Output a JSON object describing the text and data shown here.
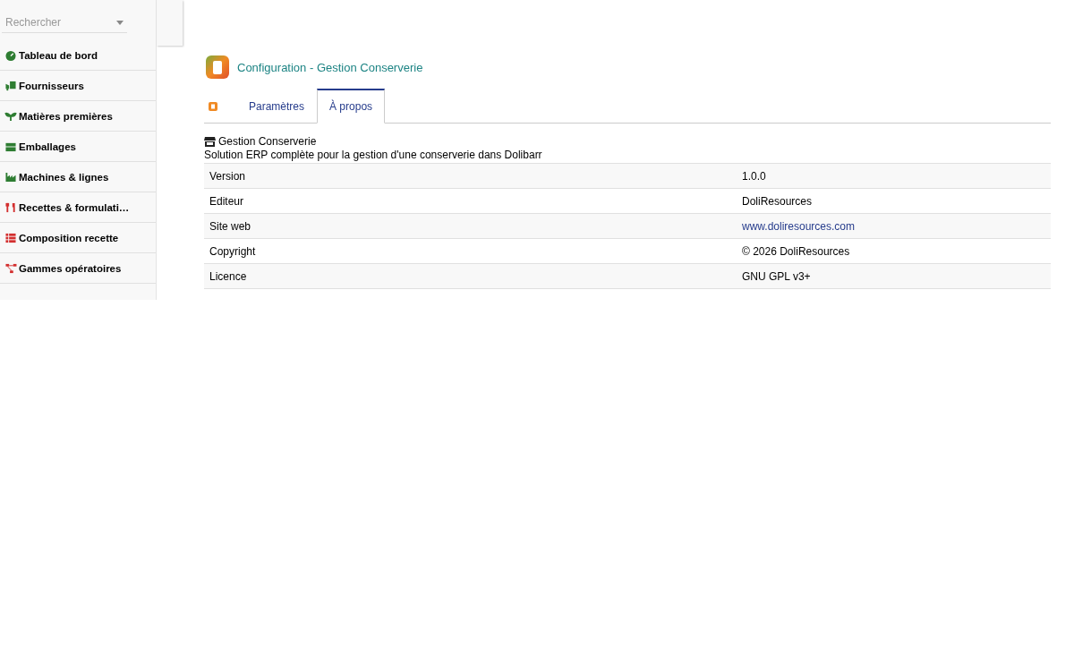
{
  "sidebar": {
    "search": {
      "placeholder": "Rechercher"
    },
    "items": [
      {
        "label": "Tableau de bord",
        "kind": "gauge",
        "color": "#2e7d32"
      },
      {
        "label": "Fournisseurs",
        "kind": "truck",
        "color": "#2e7d32"
      },
      {
        "label": "Matières premières",
        "kind": "sprout",
        "color": "#2e7d32"
      },
      {
        "label": "Emballages",
        "kind": "box",
        "color": "#2e7d32"
      },
      {
        "label": "Machines & lignes",
        "kind": "factory",
        "color": "#2e7d32"
      },
      {
        "label": "Recettes & formulati…",
        "kind": "utensils",
        "color": "#d32f2f"
      },
      {
        "label": "Composition recette",
        "kind": "list",
        "color": "#d32f2f"
      },
      {
        "label": "Gammes opératoires",
        "kind": "flow",
        "color": "#d32f2f"
      }
    ]
  },
  "page": {
    "title": "Configuration - Gestion Conserverie",
    "tabs": [
      {
        "label": "Paramètres",
        "selected": false
      },
      {
        "label": "À propos",
        "selected": true
      }
    ],
    "module_name": "Gestion Conserverie",
    "description": "Solution ERP complète pour la gestion d'une conserverie dans Dolibarr",
    "table": {
      "rows": [
        {
          "label": "Version",
          "value": "1.0.0",
          "kind": "text"
        },
        {
          "label": "Editeur",
          "value": "DoliResources",
          "kind": "text"
        },
        {
          "label": "Site web",
          "value": "www.doliresources.com",
          "kind": "link"
        },
        {
          "label": "Copyright",
          "value": "© 2026 DoliResources",
          "kind": "text"
        },
        {
          "label": "Licence",
          "value": "GNU GPL v3+",
          "kind": "text"
        }
      ]
    }
  }
}
